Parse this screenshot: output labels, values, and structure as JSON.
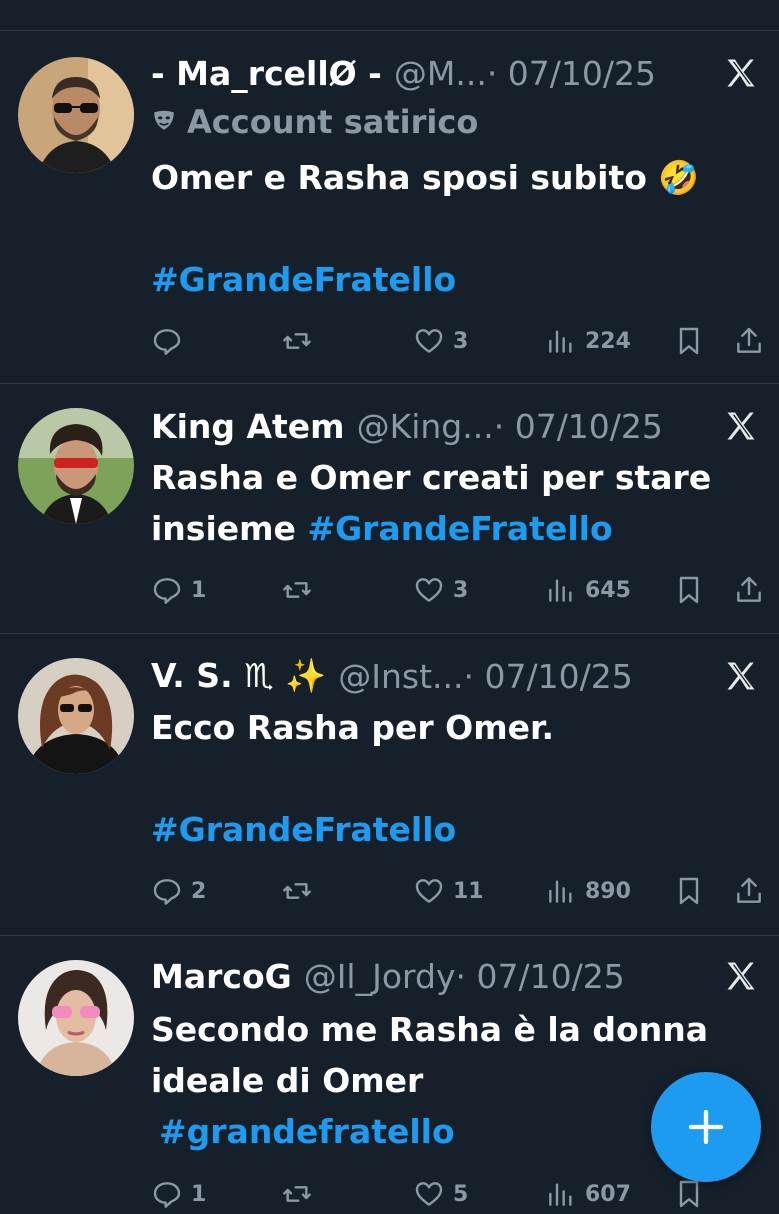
{
  "tweets": [
    {
      "name": "- Ma_rcellØ -",
      "handle": "@M...",
      "date": "· 07/10/25",
      "badge": "Account satirico",
      "text_line1": "Omer e Rasha sposi subito 🤣",
      "hashtag": "#GrandeFratello",
      "replies": "",
      "likes": "3",
      "views": "224"
    },
    {
      "name": "King Atem",
      "handle": "@King...",
      "date": "· 07/10/25",
      "text_line1": "Rasha e Omer creati per stare",
      "text_line2": "insieme",
      "hashtag": "#GrandeFratello",
      "replies": "1",
      "likes": "3",
      "views": "645"
    },
    {
      "name": "V. S. ♏ ✨",
      "handle": "@Inst...",
      "date": "· 07/10/25",
      "text_line1": "Ecco Rasha per Omer.",
      "hashtag": "#GrandeFratello",
      "replies": "2",
      "likes": "11",
      "views": "890"
    },
    {
      "name": "MarcoG",
      "handle": "@Il_Jordy",
      "date": "· 07/10/25",
      "text_line1": "Secondo me Rasha è la donna",
      "text_line2": "ideale di Omer",
      "hashtag": "#grandefratello",
      "replies": "1",
      "likes": "5",
      "views": "607"
    }
  ],
  "colors": {
    "background": "#15202b",
    "accent": "#1d9bf0",
    "muted": "#8b98a5",
    "divider": "#2f3b47"
  },
  "icons": {
    "reply": "reply-icon",
    "retweet": "retweet-icon",
    "like": "heart-icon",
    "views": "views-icon",
    "bookmark": "bookmark-icon",
    "share": "share-icon",
    "platform": "x-logo-icon",
    "compose": "plus-icon",
    "badge": "mask-icon"
  }
}
